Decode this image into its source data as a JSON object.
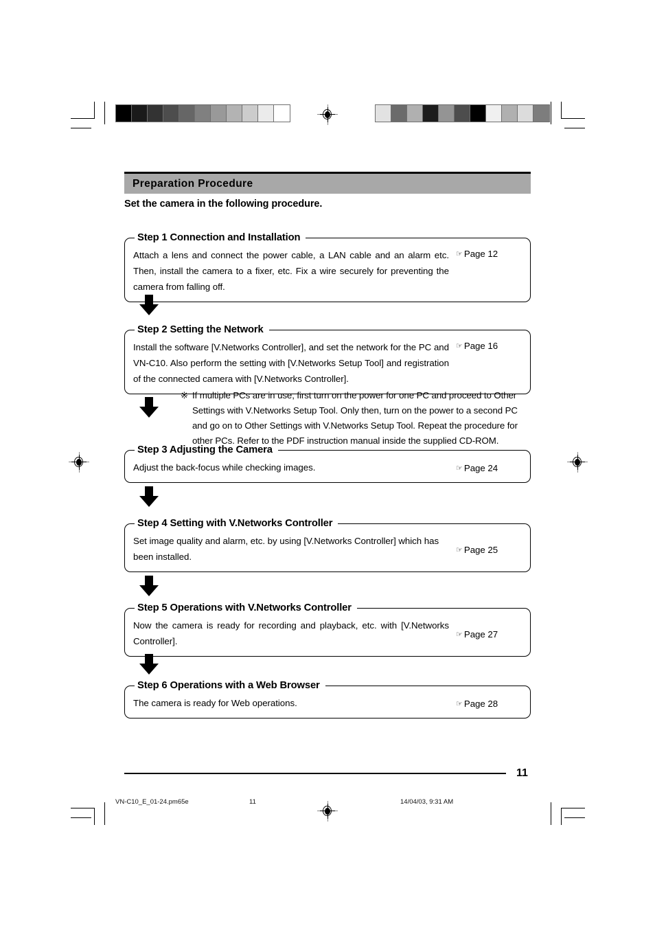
{
  "document": {
    "section_title": "Preparation Procedure",
    "intro": "Set the camera in the following procedure.",
    "page_number": "11"
  },
  "calibration": {
    "left_bar": {
      "name": "grayscale-step-wedge",
      "swatches": [
        "#000000",
        "#1a1a1a",
        "#333333",
        "#4d4d4d",
        "#666666",
        "#808080",
        "#999999",
        "#b3b3b3",
        "#cccccc",
        "#ebebeb",
        "#ffffff"
      ]
    },
    "right_bar": {
      "name": "scrambled-gray-patch-bar",
      "swatches": [
        "#e2e2e2",
        "#6b6b6b",
        "#b0b0b0",
        "#1c1c1c",
        "#949494",
        "#4d4d4d",
        "#000000",
        "#f0f0f0",
        "#b0b0b0",
        "#dcdcdc",
        "#7d7d7d"
      ]
    }
  },
  "steps": [
    {
      "title": "Step 1 Connection and Installation",
      "body": "Attach a lens and connect the power cable, a LAN cable and an alarm etc. Then, install the camera to a fixer, etc. Fix a wire securely for preventing the camera from falling off.",
      "ref_icon": "pointing-hand-icon",
      "ref": "Page 12"
    },
    {
      "title": "Step 2 Setting the Network",
      "body": "Install the software [V.Networks Controller], and set the network for the PC and VN-C10.  Also perform the setting with [V.Networks Setup Tool] and registration of the connected camera with [V.Networks Controller].",
      "ref_icon": "pointing-hand-icon",
      "ref": "Page 16"
    },
    {
      "title": "Step 3 Adjusting the Camera",
      "body": "Adjust the back-focus while checking images.",
      "ref_icon": "pointing-hand-icon",
      "ref": "Page 24"
    },
    {
      "title": "Step 4 Setting with V.Networks Controller",
      "body": "Set image quality and alarm, etc. by using [V.Networks Controller] which has been installed.",
      "ref_icon": "pointing-hand-icon",
      "ref": "Page 25"
    },
    {
      "title": "Step 5 Operations with V.Networks Controller",
      "body": "Now the camera is ready for recording and playback, etc. with [V.Networks Controller].",
      "ref_icon": "pointing-hand-icon",
      "ref": "Page 27"
    },
    {
      "title": "Step 6 Operations with a Web Browser",
      "body": "The camera is ready for Web operations.",
      "ref_icon": "pointing-hand-icon",
      "ref": "Page 28"
    }
  ],
  "note": {
    "mark": "※",
    "text": "If multiple PCs are in use, first turn on the power for one PC and proceed to Other Settings with V.Networks Setup Tool. Only then, turn on the power to a second PC and go on to Other Settings with V.Networks Setup Tool. Repeat the procedure for other PCs.  Refer to the PDF instruction manual inside the supplied CD-ROM."
  },
  "footer": {
    "file_name": "VN-C10_E_01-24.pm65e",
    "page": "11",
    "timestamp": "14/04/03, 9:31 AM"
  },
  "icons": {
    "hand": "☞"
  }
}
